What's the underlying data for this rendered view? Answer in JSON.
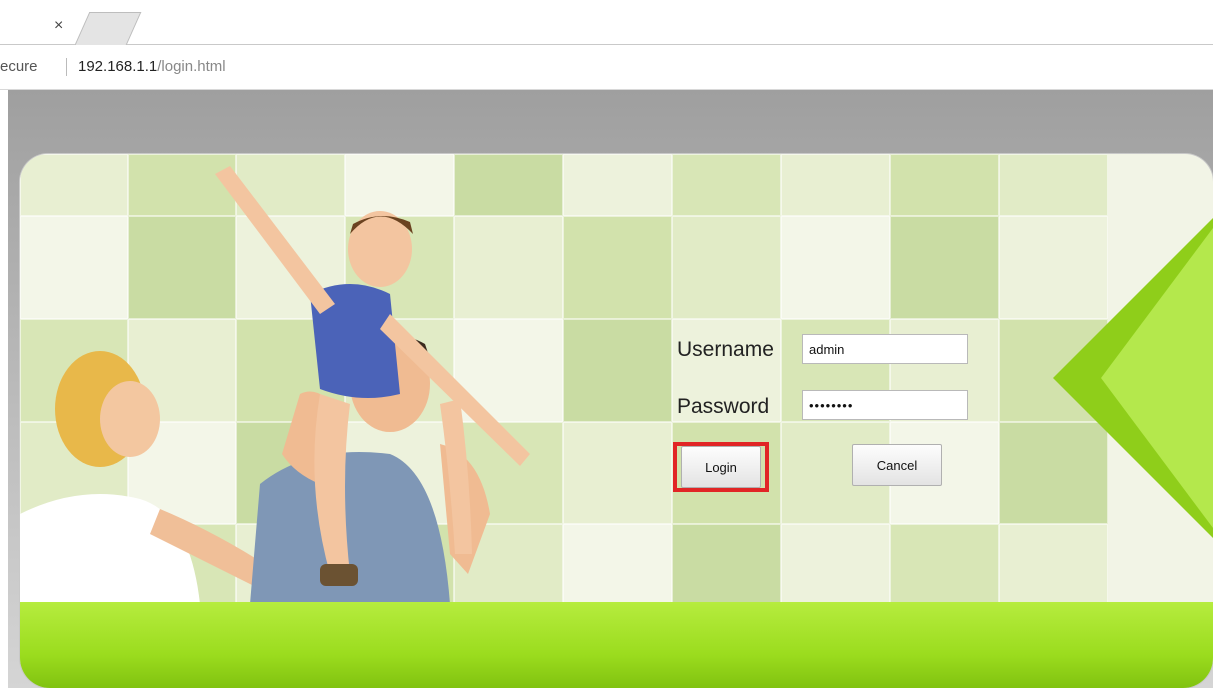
{
  "browser": {
    "tab_close_glyph": "×",
    "secure_text": "ecure",
    "url_host": "192.168.1.1",
    "url_path": "/login.html"
  },
  "login": {
    "username_label": "Username",
    "username_value": "admin",
    "password_label": "Password",
    "password_value": "••••••••",
    "login_label": "Login",
    "cancel_label": "Cancel"
  },
  "colors": {
    "accent_green": "#9bdc1e",
    "highlight_red": "#e12525"
  }
}
